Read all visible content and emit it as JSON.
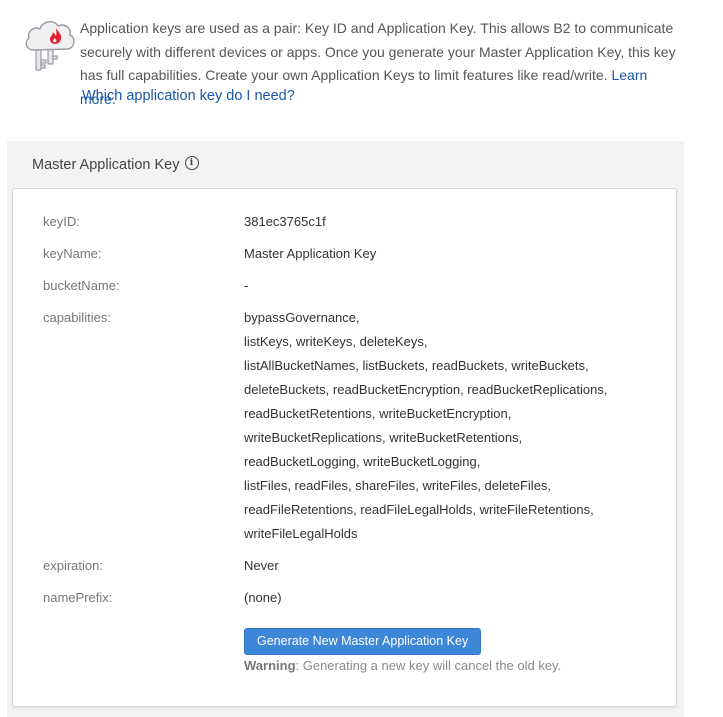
{
  "intro": {
    "text": "Application keys are used as a pair: Key ID and Application Key. This allows B2 to communicate securely with different devices or apps. Once you generate your Master Application Key, this key has full capabilities. Create your own Application Keys to limit features like read/write.",
    "learn_more": "Learn more.",
    "which_key_link": "Which application key do I need?",
    "icon": "cloud-keys-icon",
    "accent_color": "#e2202b"
  },
  "panel": {
    "title": "Master Application Key",
    "info_icon": "info-icon",
    "rows": {
      "keyid_label": "keyID:",
      "keyid_value": "381ec3765c1f",
      "keyname_label": "keyName:",
      "keyname_value": "Master Application Key",
      "bucketname_label": "bucketName:",
      "bucketname_value": "-",
      "capabilities_label": "capabilities:",
      "capabilities_lines": [
        "bypassGovernance,",
        "listKeys, writeKeys, deleteKeys,",
        "listAllBucketNames, listBuckets, readBuckets, writeBuckets,",
        "deleteBuckets, readBucketEncryption, readBucketReplications,",
        "readBucketRetentions, writeBucketEncryption,",
        "writeBucketReplications, writeBucketRetentions,",
        "readBucketLogging, writeBucketLogging,",
        "listFiles, readFiles, shareFiles, writeFiles, deleteFiles,",
        "readFileRetentions, readFileLegalHolds, writeFileRetentions,",
        "writeFileLegalHolds"
      ],
      "expiration_label": "expiration:",
      "expiration_value": "Never",
      "nameprefix_label": "namePrefix:",
      "nameprefix_value": "(none)"
    },
    "generate_button": "Generate New Master Application Key",
    "warning_label": "Warning",
    "warning_text": ": Generating a new key will cancel the old key.",
    "button_color": "#3d87d9"
  }
}
